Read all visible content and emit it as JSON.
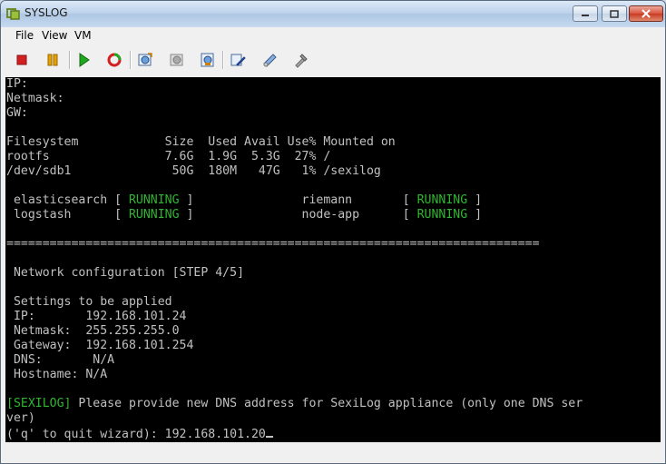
{
  "window": {
    "title": "SYSLOG",
    "minimize_icon": "minimize-icon",
    "maximize_icon": "maximize-icon",
    "close_icon": "close-icon"
  },
  "menu": {
    "file": "File",
    "view": "View",
    "vm": "VM"
  },
  "toolbar": {
    "icons": [
      "power-off-icon",
      "suspend-icon",
      "power-on-icon",
      "reset-icon",
      "snapshot-icon",
      "revert-snapshot-icon",
      "manage-snapshots-icon",
      "edit-settings-icon",
      "connect-device-icon",
      "install-tools-icon"
    ],
    "colors": {
      "stop": "#d21f1f",
      "pause": "#e8a000",
      "play": "#1fa81f"
    }
  },
  "console": {
    "ip": "IP:",
    "netmask": "Netmask:",
    "gw": "GW:",
    "fs_header": "Filesystem            Size  Used Avail Use% Mounted on",
    "fs_rows": [
      "rootfs                7.6G  1.9G  5.3G  27% /",
      "/dev/sdb1              50G  180M   47G   1% /sexilog"
    ],
    "services": [
      {
        "name": " elasticsearch [ ",
        "state": "RUNNING",
        "tail": " ]               ",
        "name2": "riemann       [ ",
        "state2": "RUNNING",
        "tail2": " ]"
      },
      {
        "name": " logstash      [ ",
        "state": "RUNNING",
        "tail": " ]               ",
        "name2": "node-app      [ ",
        "state2": "RUNNING",
        "tail2": " ]"
      }
    ],
    "separator": "==========================================================================",
    "step_title": " Network configuration [STEP 4/5]",
    "settings_title": " Settings to be applied",
    "settings": [
      " IP:       192.168.101.24",
      " Netmask:  255.255.255.0",
      " Gateway:  192.168.101.254",
      " DNS:       N/A",
      " Hostname: N/A"
    ],
    "prompt_tag": "[SEXILOG]",
    "prompt_text": " Please provide new DNS address for SexiLog appliance (only one DNS ser",
    "prompt_wrap": "ver)",
    "prompt_quit": "('q' to quit wizard): ",
    "input_value": "192.168.101.20",
    "colors": {
      "text": "#c0c0c0",
      "green": "#2fb52f",
      "bg": "#000000"
    }
  }
}
